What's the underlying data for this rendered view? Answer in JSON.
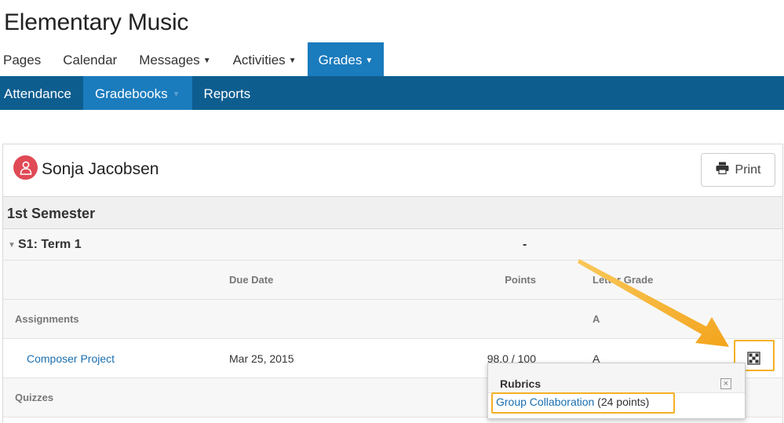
{
  "course": {
    "title": "Elementary Music"
  },
  "main_nav": [
    {
      "label": "Pages",
      "dropdown": false,
      "active": false
    },
    {
      "label": "Calendar",
      "dropdown": false,
      "active": false
    },
    {
      "label": "Messages",
      "dropdown": true,
      "active": false
    },
    {
      "label": "Activities",
      "dropdown": true,
      "active": false
    },
    {
      "label": "Grades",
      "dropdown": true,
      "active": true
    }
  ],
  "sub_nav": [
    {
      "label": "Attendance",
      "active": false
    },
    {
      "label": "Gradebooks",
      "active": true
    },
    {
      "label": "Reports",
      "active": false
    }
  ],
  "student": {
    "name": "Sonja Jacobsen"
  },
  "print_label": "Print",
  "semester": {
    "title": "1st Semester"
  },
  "term": {
    "title": "S1: Term 1",
    "grade": "-"
  },
  "columns": {
    "due_date": "Due Date",
    "points": "Points",
    "letter_grade": "Letter Grade"
  },
  "categories": [
    {
      "label": "Assignments",
      "letter": "A"
    },
    {
      "label": "Quizzes",
      "letter": ""
    }
  ],
  "assignment": {
    "name": "Composer Project",
    "due": "Mar 25, 2015",
    "points": "98.0 / 100",
    "letter": "A"
  },
  "rubric_popup": {
    "title": "Rubrics",
    "close_symbol": "×",
    "item_link": "Group Collaboration",
    "item_points": " (24 points)"
  },
  "colors": {
    "accent_blue": "#1a7bbd",
    "dark_blue": "#0d5d8f",
    "avatar_red": "#e04a55",
    "highlight": "#f5b025"
  },
  "icons": {
    "avatar": "user-icon",
    "print": "printer-icon",
    "rubric": "rubric-grid-icon"
  }
}
